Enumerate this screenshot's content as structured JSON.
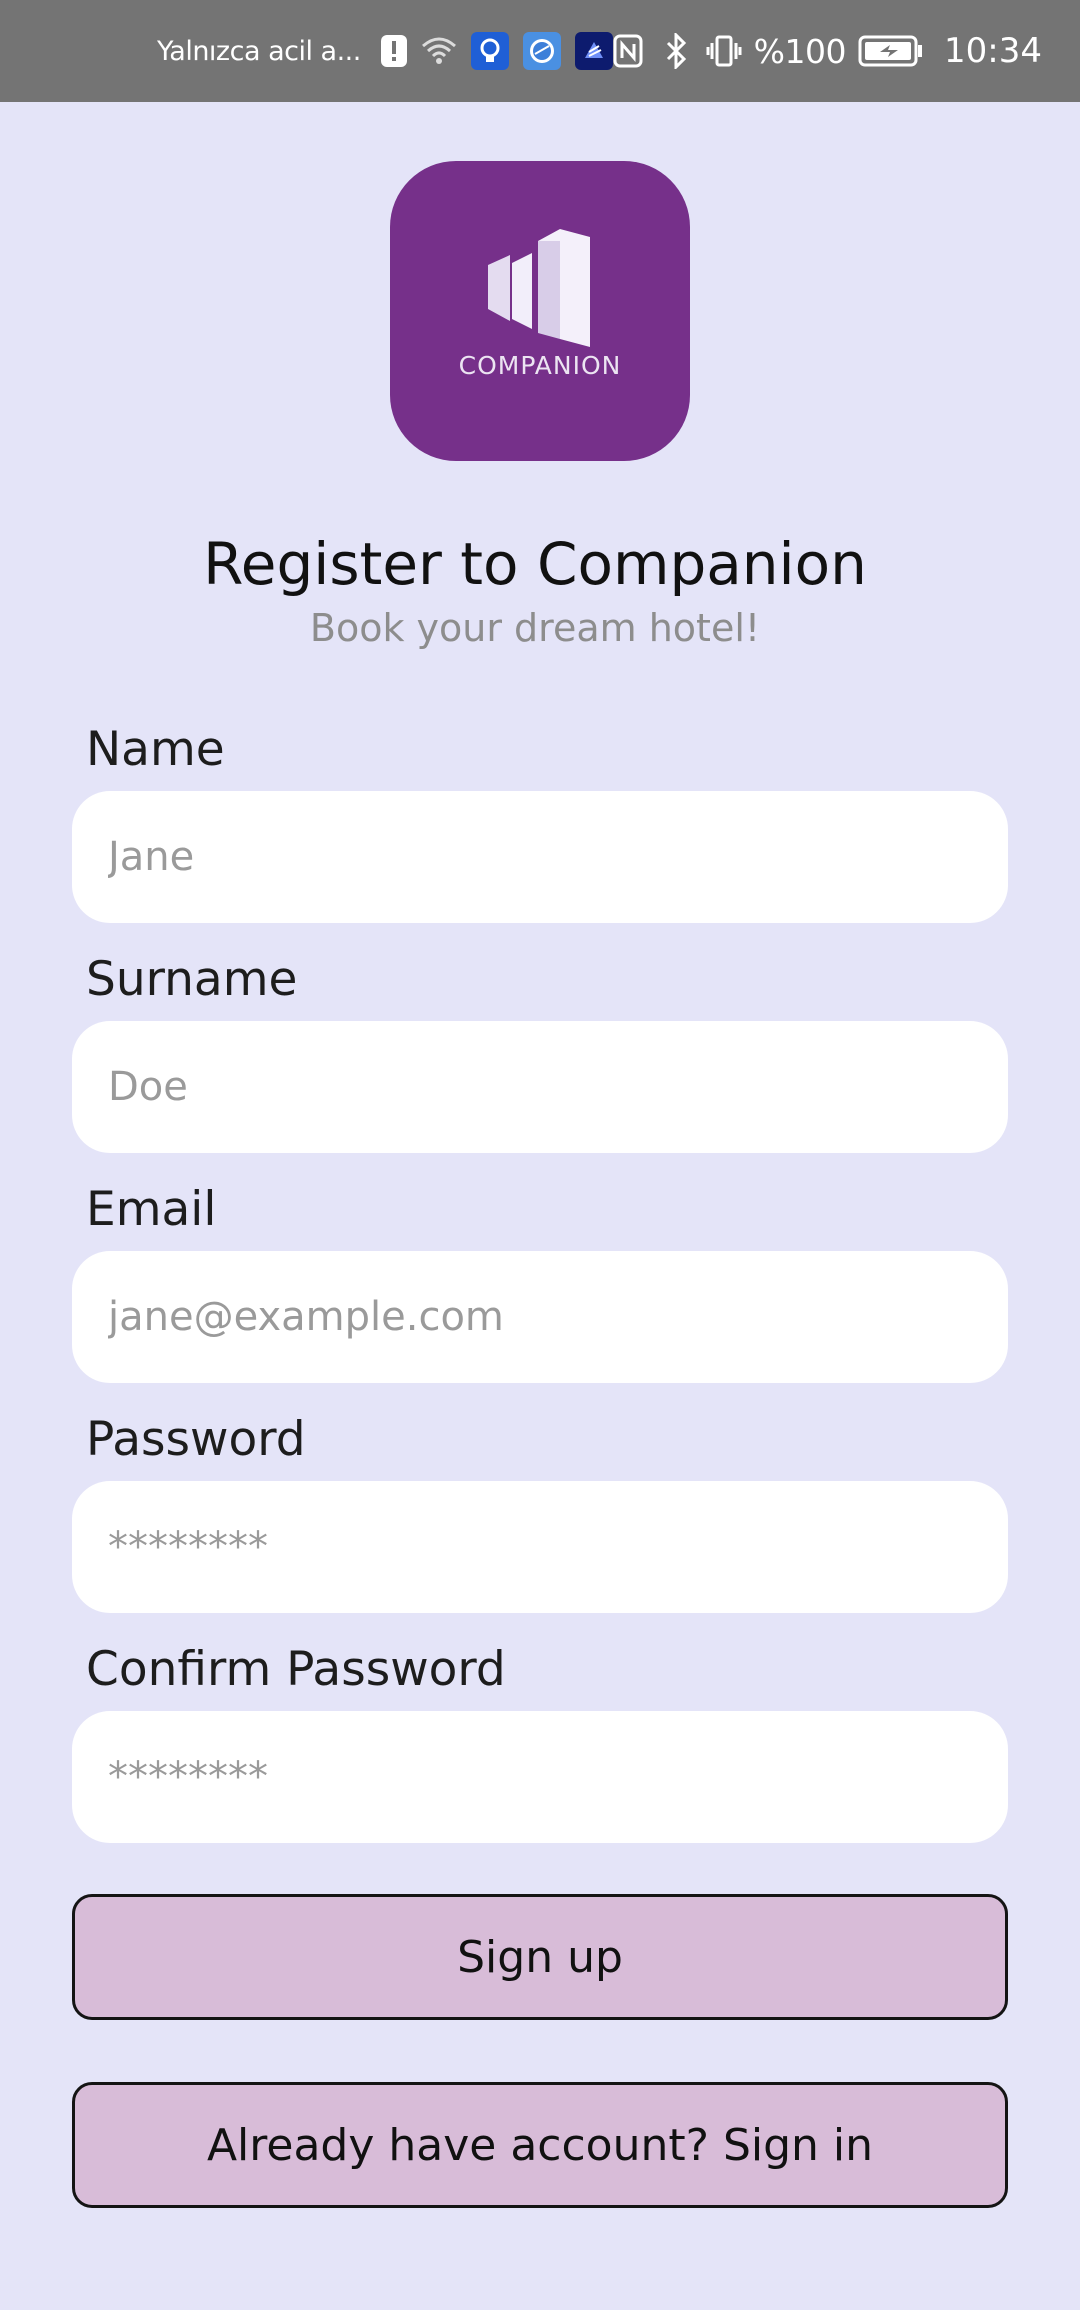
{
  "status_bar": {
    "notification_text": "Yalnızca acil a...",
    "battery": "%100",
    "time": "10:34",
    "icons": [
      "alert-icon",
      "wifi-icon",
      "lightbulb-app-icon",
      "browser-app-icon",
      "app-icon",
      "nfc-icon",
      "bluetooth-icon",
      "vibrate-icon",
      "battery-icon"
    ]
  },
  "logo": {
    "text": "COMPANION",
    "color": "#76308a"
  },
  "header": {
    "title": "Register to Companion",
    "subtitle": "Book your dream hotel!"
  },
  "form": {
    "name": {
      "label": "Name",
      "placeholder": "Jane",
      "value": ""
    },
    "surname": {
      "label": "Surname",
      "placeholder": "Doe",
      "value": ""
    },
    "email": {
      "label": "Email",
      "placeholder": "jane@example.com",
      "value": ""
    },
    "password": {
      "label": "Password",
      "placeholder": "********",
      "value": ""
    },
    "confirm_password": {
      "label": "Confirm Password",
      "placeholder": "********",
      "value": ""
    }
  },
  "buttons": {
    "sign_up": "Sign up",
    "sign_in": "Already have account? Sign in"
  },
  "colors": {
    "background": "#e4e4f8",
    "button": "#d8bcd8",
    "status_bar": "#747474"
  }
}
